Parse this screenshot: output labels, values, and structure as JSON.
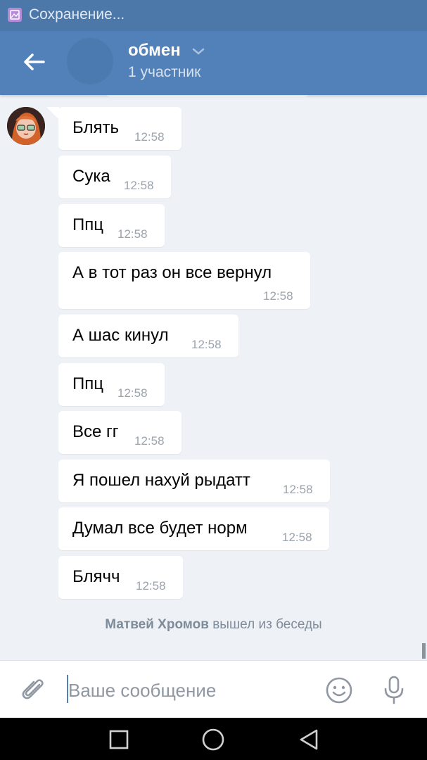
{
  "status_bar": {
    "text": "Сохранение..."
  },
  "header": {
    "title": "обмен",
    "subtitle": "1 участник"
  },
  "messages": [
    {
      "text": "Блять",
      "time": "12:58"
    },
    {
      "text": "Сука",
      "time": "12:58"
    },
    {
      "text": "Ппц",
      "time": "12:58"
    },
    {
      "text": "А в тот раз он все вернул",
      "time": "12:58"
    },
    {
      "text": "А шас кинул",
      "time": "12:58"
    },
    {
      "text": "Ппц",
      "time": "12:58"
    },
    {
      "text": "Все гг",
      "time": "12:58"
    },
    {
      "text": "Я пошел нахуй рыдатт",
      "time": "12:58"
    },
    {
      "text": "Думал все будет норм",
      "time": "12:58"
    },
    {
      "text": "Блячч",
      "time": "12:58"
    }
  ],
  "system_message": {
    "name": "Матвей Хромов",
    "action": "вышел из беседы"
  },
  "composer": {
    "placeholder": "Ваше сообщение"
  },
  "icons": {
    "back": "arrow-left-icon",
    "chevron": "chevron-down-icon",
    "attach": "paperclip-icon",
    "emoji": "smiley-icon",
    "mic": "microphone-icon",
    "nav_recent": "square-icon",
    "nav_home": "circle-icon",
    "nav_back": "triangle-back-icon"
  },
  "colors": {
    "header": "#5181b8",
    "status_bar": "#4c77a9",
    "background": "#eef1f5",
    "bubble": "#ffffff",
    "time": "#9aa2ab"
  }
}
